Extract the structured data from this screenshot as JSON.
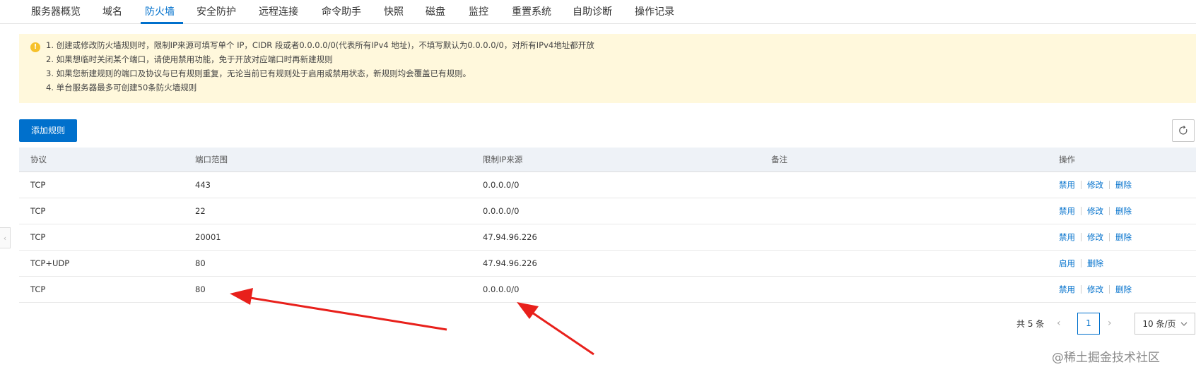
{
  "tabs": [
    {
      "label": "服务器概览"
    },
    {
      "label": "域名"
    },
    {
      "label": "防火墙"
    },
    {
      "label": "安全防护"
    },
    {
      "label": "远程连接"
    },
    {
      "label": "命令助手"
    },
    {
      "label": "快照"
    },
    {
      "label": "磁盘"
    },
    {
      "label": "监控"
    },
    {
      "label": "重置系统"
    },
    {
      "label": "自助诊断"
    },
    {
      "label": "操作记录"
    }
  ],
  "active_tab": "防火墙",
  "notice": {
    "icon": "warning-icon",
    "lines": [
      "1. 创建或修改防火墙规则时，限制IP来源可填写单个 IP，CIDR 段或者0.0.0.0/0(代表所有IPv4 地址)，不填写默认为0.0.0.0/0，对所有IPv4地址都开放",
      "2. 如果想临时关闭某个端口，请使用禁用功能，免于开放对应端口时再新建规则",
      "3. 如果您新建规则的端口及协议与已有规则重复，无论当前已有规则处于启用或禁用状态，新规则均会覆盖已有规则。",
      "4. 单台服务器最多可创建50条防火墙规则"
    ]
  },
  "toolbar": {
    "add_label": "添加规则",
    "refresh_icon": "refresh-icon"
  },
  "table": {
    "headers": [
      "协议",
      "端口范围",
      "限制IP来源",
      "备注",
      "操作"
    ],
    "rows": [
      {
        "protocol": "TCP",
        "port": "443",
        "source": "0.0.0.0/0",
        "note": "",
        "actions": [
          "禁用",
          "修改",
          "删除"
        ]
      },
      {
        "protocol": "TCP",
        "port": "22",
        "source": "0.0.0.0/0",
        "note": "",
        "actions": [
          "禁用",
          "修改",
          "删除"
        ]
      },
      {
        "protocol": "TCP",
        "port": "20001",
        "source": "47.94.96.226",
        "note": "",
        "actions": [
          "禁用",
          "修改",
          "删除"
        ]
      },
      {
        "protocol": "TCP+UDP",
        "port": "80",
        "source": "47.94.96.226",
        "note": "",
        "actions": [
          "启用",
          "删除"
        ]
      },
      {
        "protocol": "TCP",
        "port": "80",
        "source": "0.0.0.0/0",
        "note": "",
        "actions": [
          "禁用",
          "修改",
          "删除"
        ]
      }
    ]
  },
  "pagination": {
    "total": "共 5 条",
    "current_page": "1",
    "page_size": "10 条/页"
  },
  "watermark": "@稀土掘金技术社区",
  "colors": {
    "accent": "#0070cc",
    "notice_bg": "#fff8dc",
    "annotation_arrow": "#e8201b"
  }
}
